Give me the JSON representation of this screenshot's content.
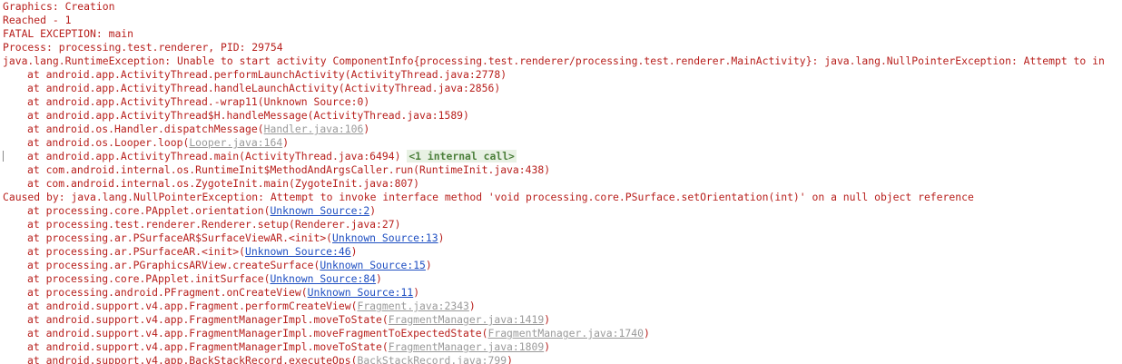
{
  "lines": [
    {
      "kind": "plain",
      "text": "Graphics: Creation"
    },
    {
      "kind": "plain",
      "text": "Reached - 1"
    },
    {
      "kind": "plain",
      "text": "FATAL EXCEPTION: main"
    },
    {
      "kind": "plain",
      "text": "Process: processing.test.renderer, PID: 29754"
    },
    {
      "kind": "plain",
      "text": "java.lang.RuntimeException: Unable to start activity ComponentInfo{processing.test.renderer/processing.test.renderer.MainActivity}: java.lang.NullPointerException: Attempt to in"
    },
    {
      "kind": "frame",
      "pre": "at android.app.ActivityThread.performLaunchActivity(ActivityThread.java:2778)",
      "link": "",
      "linkStyle": "",
      "post": "",
      "badge": ""
    },
    {
      "kind": "frame",
      "pre": "at android.app.ActivityThread.handleLaunchActivity(ActivityThread.java:2856)",
      "link": "",
      "linkStyle": "",
      "post": "",
      "badge": ""
    },
    {
      "kind": "frame",
      "pre": "at android.app.ActivityThread.-wrap11(Unknown Source:0)",
      "link": "",
      "linkStyle": "",
      "post": "",
      "badge": ""
    },
    {
      "kind": "frame",
      "pre": "at android.app.ActivityThread$H.handleMessage(ActivityThread.java:1589)",
      "link": "",
      "linkStyle": "",
      "post": "",
      "badge": ""
    },
    {
      "kind": "frame",
      "pre": "at android.os.Handler.dispatchMessage(",
      "link": "Handler.java:106",
      "linkStyle": "gray",
      "post": ")",
      "badge": ""
    },
    {
      "kind": "frame",
      "pre": "at android.os.Looper.loop(",
      "link": "Looper.java:164",
      "linkStyle": "gray",
      "post": ")",
      "badge": ""
    },
    {
      "kind": "frame",
      "pre": "at android.app.ActivityThread.main(ActivityThread.java:6494) ",
      "link": "",
      "linkStyle": "",
      "post": "",
      "badge": "<1 internal call>",
      "gutter": true
    },
    {
      "kind": "frame",
      "pre": "at com.android.internal.os.RuntimeInit$MethodAndArgsCaller.run(RuntimeInit.java:438)",
      "link": "",
      "linkStyle": "",
      "post": "",
      "badge": ""
    },
    {
      "kind": "frame",
      "pre": "at com.android.internal.os.ZygoteInit.main(ZygoteInit.java:807)",
      "link": "",
      "linkStyle": "",
      "post": "",
      "badge": ""
    },
    {
      "kind": "plain",
      "text": "Caused by: java.lang.NullPointerException: Attempt to invoke interface method 'void processing.core.PSurface.setOrientation(int)' on a null object reference"
    },
    {
      "kind": "frame",
      "pre": "at processing.core.PApplet.orientation(",
      "link": "Unknown Source:2",
      "linkStyle": "blue",
      "post": ")",
      "badge": ""
    },
    {
      "kind": "frame",
      "pre": "at processing.test.renderer.Renderer.setup(Renderer.java:27)",
      "link": "",
      "linkStyle": "",
      "post": "",
      "badge": ""
    },
    {
      "kind": "frame",
      "pre": "at processing.ar.PSurfaceAR$SurfaceViewAR.<init>(",
      "link": "Unknown Source:13",
      "linkStyle": "blue",
      "post": ")",
      "badge": ""
    },
    {
      "kind": "frame",
      "pre": "at processing.ar.PSurfaceAR.<init>(",
      "link": "Unknown Source:46",
      "linkStyle": "blue",
      "post": ")",
      "badge": ""
    },
    {
      "kind": "frame",
      "pre": "at processing.ar.PGraphicsARView.createSurface(",
      "link": "Unknown Source:15",
      "linkStyle": "blue",
      "post": ")",
      "badge": ""
    },
    {
      "kind": "frame",
      "pre": "at processing.core.PApplet.initSurface(",
      "link": "Unknown Source:84",
      "linkStyle": "blue",
      "post": ")",
      "badge": ""
    },
    {
      "kind": "frame",
      "pre": "at processing.android.PFragment.onCreateView(",
      "link": "Unknown Source:11",
      "linkStyle": "blue",
      "post": ")",
      "badge": ""
    },
    {
      "kind": "frame",
      "pre": "at android.support.v4.app.Fragment.performCreateView(",
      "link": "Fragment.java:2343",
      "linkStyle": "gray",
      "post": ")",
      "badge": ""
    },
    {
      "kind": "frame",
      "pre": "at android.support.v4.app.FragmentManagerImpl.moveToState(",
      "link": "FragmentManager.java:1419",
      "linkStyle": "gray",
      "post": ")",
      "badge": ""
    },
    {
      "kind": "frame",
      "pre": "at android.support.v4.app.FragmentManagerImpl.moveFragmentToExpectedState(",
      "link": "FragmentManager.java:1740",
      "linkStyle": "gray",
      "post": ")",
      "badge": ""
    },
    {
      "kind": "frame",
      "pre": "at android.support.v4.app.FragmentManagerImpl.moveToState(",
      "link": "FragmentManager.java:1809",
      "linkStyle": "gray",
      "post": ")",
      "badge": ""
    },
    {
      "kind": "frame",
      "pre": "at android.support.v4.app.BackStackRecord.executeOps(",
      "link": "BackStackRecord.java:799",
      "linkStyle": "gray",
      "post": ")",
      "badge": ""
    }
  ]
}
